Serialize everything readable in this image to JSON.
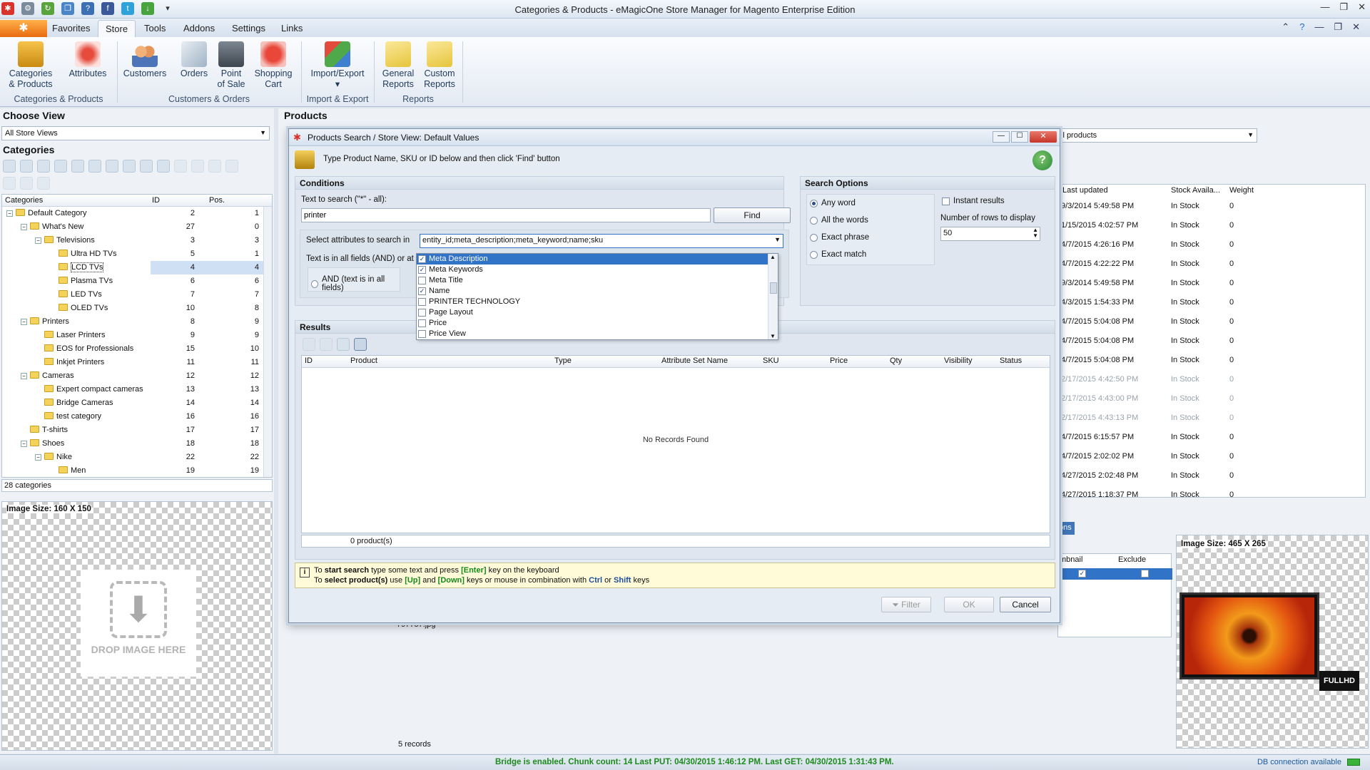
{
  "window": {
    "title": "Categories & Products - eMagicOne Store Manager for Magento Enterprise Edition"
  },
  "ribbon": {
    "app_button": "✱",
    "tabs": [
      "Favorites",
      "Store",
      "Tools",
      "Addons",
      "Settings",
      "Links"
    ],
    "active_tab": "Store",
    "buttons": {
      "categories": "Categories",
      "categories2": "& Products",
      "attributes": "Attributes",
      "customers": "Customers",
      "orders": "Orders",
      "pos": "Point",
      "pos2": "of Sale",
      "cart": "Shopping",
      "cart2": "Cart",
      "import": "Import/Export",
      "general": "General",
      "general2": "Reports",
      "custom": "Custom",
      "custom2": "Reports"
    },
    "groups": {
      "g1": "Categories & Products",
      "g2": "Customers & Orders",
      "g3": "Import & Export",
      "g4": "Reports"
    }
  },
  "left": {
    "choose_view": "Choose View",
    "store_view": "All Store Views",
    "categories_title": "Categories",
    "headers": {
      "name": "Categories",
      "id": "ID",
      "pos": "Pos."
    },
    "rows": [
      {
        "name": "Default Category",
        "id": "2",
        "pos": "1",
        "level": 0,
        "exp": "−"
      },
      {
        "name": "What's New",
        "id": "27",
        "pos": "0",
        "level": 1,
        "exp": "−"
      },
      {
        "name": "Televisions",
        "id": "3",
        "pos": "3",
        "level": 2,
        "exp": "−"
      },
      {
        "name": "Ultra HD TVs",
        "id": "5",
        "pos": "1",
        "level": 3,
        "exp": ""
      },
      {
        "name": "LCD TVs",
        "id": "4",
        "pos": "4",
        "level": 3,
        "exp": "",
        "selected": true
      },
      {
        "name": "Plasma TVs",
        "id": "6",
        "pos": "6",
        "level": 3,
        "exp": ""
      },
      {
        "name": "LED TVs",
        "id": "7",
        "pos": "7",
        "level": 3,
        "exp": ""
      },
      {
        "name": "OLED TVs",
        "id": "10",
        "pos": "8",
        "level": 3,
        "exp": ""
      },
      {
        "name": "Printers",
        "id": "8",
        "pos": "9",
        "level": 1,
        "exp": "−"
      },
      {
        "name": "Laser Printers",
        "id": "9",
        "pos": "9",
        "level": 2,
        "exp": ""
      },
      {
        "name": "EOS for Professionals",
        "id": "15",
        "pos": "10",
        "level": 2,
        "exp": ""
      },
      {
        "name": "Inkjet Printers",
        "id": "11",
        "pos": "11",
        "level": 2,
        "exp": ""
      },
      {
        "name": "Cameras",
        "id": "12",
        "pos": "12",
        "level": 1,
        "exp": "−"
      },
      {
        "name": "Expert compact cameras",
        "id": "13",
        "pos": "13",
        "level": 2,
        "exp": ""
      },
      {
        "name": "Bridge Cameras",
        "id": "14",
        "pos": "14",
        "level": 2,
        "exp": ""
      },
      {
        "name": "test category",
        "id": "16",
        "pos": "16",
        "level": 2,
        "exp": ""
      },
      {
        "name": "T-shirts",
        "id": "17",
        "pos": "17",
        "level": 1,
        "exp": ""
      },
      {
        "name": "Shoes",
        "id": "18",
        "pos": "18",
        "level": 1,
        "exp": "−"
      },
      {
        "name": "Nike",
        "id": "22",
        "pos": "22",
        "level": 2,
        "exp": "−"
      },
      {
        "name": "Men",
        "id": "19",
        "pos": "19",
        "level": 3,
        "exp": ""
      }
    ],
    "count": "28 categories",
    "image_size": "Image Size: 160 X 150",
    "drop_text": "DROP IMAGE HERE"
  },
  "products": {
    "title": "Products",
    "filter": "ll products",
    "headers": {
      "updated": "Last updated",
      "stock": "Stock Availa...",
      "weight": "Weight"
    },
    "rows": [
      {
        "updated": "9/3/2014 5:49:58 PM",
        "stock": "In Stock",
        "weight": "0"
      },
      {
        "updated": "1/15/2015 4:02:57 PM",
        "stock": "In Stock",
        "weight": "0"
      },
      {
        "updated": "4/7/2015 4:26:16 PM",
        "stock": "In Stock",
        "weight": "0"
      },
      {
        "updated": "4/7/2015 4:22:22 PM",
        "stock": "In Stock",
        "weight": "0"
      },
      {
        "updated": "9/3/2014 5:49:58 PM",
        "stock": "In Stock",
        "weight": "0"
      },
      {
        "updated": "4/3/2015 1:54:33 PM",
        "stock": "In Stock",
        "weight": "0"
      },
      {
        "updated": "4/7/2015 5:04:08 PM",
        "stock": "In Stock",
        "weight": "0"
      },
      {
        "updated": "4/7/2015 5:04:08 PM",
        "stock": "In Stock",
        "weight": "0"
      },
      {
        "updated": "4/7/2015 5:04:08 PM",
        "stock": "In Stock",
        "weight": "0"
      },
      {
        "updated": "2/17/2015 4:42:50 PM",
        "stock": "In Stock",
        "weight": "0",
        "dim": true
      },
      {
        "updated": "2/17/2015 4:43:00 PM",
        "stock": "In Stock",
        "weight": "0",
        "dim": true
      },
      {
        "updated": "2/17/2015 4:43:13 PM",
        "stock": "In Stock",
        "weight": "0",
        "dim": true
      },
      {
        "updated": "4/7/2015 6:15:57 PM",
        "stock": "In Stock",
        "weight": "0"
      },
      {
        "updated": "4/7/2015 2:02:02 PM",
        "stock": "In Stock",
        "weight": "0"
      },
      {
        "updated": "4/27/2015 2:02:48 PM",
        "stock": "In Stock",
        "weight": "0"
      },
      {
        "updated": "4/27/2015 1:18:37 PM",
        "stock": "In Stock",
        "weight": "0"
      }
    ],
    "lower_tab": "ons",
    "lower_headers": {
      "thumb": "mbnail",
      "exclude": "Exclude"
    },
    "lower_file": "797757.jpg",
    "records": "5 records",
    "image_size": "Image Size: 465 X 265",
    "tv_badge": "FULLHD"
  },
  "dialog": {
    "title": "Products Search / Store View: Default Values",
    "instruction": "Type Product Name, SKU or ID below and then click 'Find' button",
    "conditions": "Conditions",
    "text_label": "Text to search (\"*\" - all):",
    "search_value": "printer",
    "find": "Find",
    "attr_label": "Select attributes to search in",
    "attr_value": "entity_id;meta_description;meta_keyword;name;sku",
    "mode_label": "Text is in all fields (AND) or at",
    "and_label": "AND (text is in all fields)",
    "dropdown": [
      {
        "label": "Meta Description",
        "checked": true,
        "selected": true
      },
      {
        "label": "Meta Keywords",
        "checked": true
      },
      {
        "label": "Meta Title",
        "checked": false
      },
      {
        "label": "Name",
        "checked": true
      },
      {
        "label": "PRINTER TECHNOLOGY",
        "checked": false
      },
      {
        "label": "Page Layout",
        "checked": false
      },
      {
        "label": "Price",
        "checked": false
      },
      {
        "label": "Price View",
        "checked": false
      }
    ],
    "search_options": "Search Options",
    "opt_any": "Any word",
    "opt_all": "All the words",
    "opt_exact_phrase": "Exact phrase",
    "opt_exact_match": "Exact match",
    "instant": "Instant results",
    "rows_label": "Number of rows to display",
    "rows_value": "50",
    "results": "Results",
    "cols": [
      "ID",
      "Product",
      "Type",
      "Attribute Set Name",
      "SKU",
      "Price",
      "Qty",
      "Visibility",
      "Status"
    ],
    "no_records": "No Records Found",
    "count": "0 product(s)",
    "hint1a": "To ",
    "hint1b": "start search",
    "hint1c": " type some text and press ",
    "hint1d": "[Enter]",
    "hint1e": " key on the keyboard",
    "hint2a": "To ",
    "hint2b": "select product(s)",
    "hint2c": " use ",
    "hint2d": "[Up]",
    "hint2e": " and ",
    "hint2f": "[Down]",
    "hint2g": " keys or mouse in combination with ",
    "hint2h": "Ctrl",
    "hint2i": " or ",
    "hint2j": "Shift",
    "hint2k": " keys",
    "filter": "Filter",
    "ok": "OK",
    "cancel": "Cancel"
  },
  "status": {
    "bridge": "Bridge is enabled. Chunk count: 14 Last PUT: 04/30/2015 1:46:12 PM. Last GET: 04/30/2015 1:31:43 PM.",
    "db": "DB connection available"
  }
}
